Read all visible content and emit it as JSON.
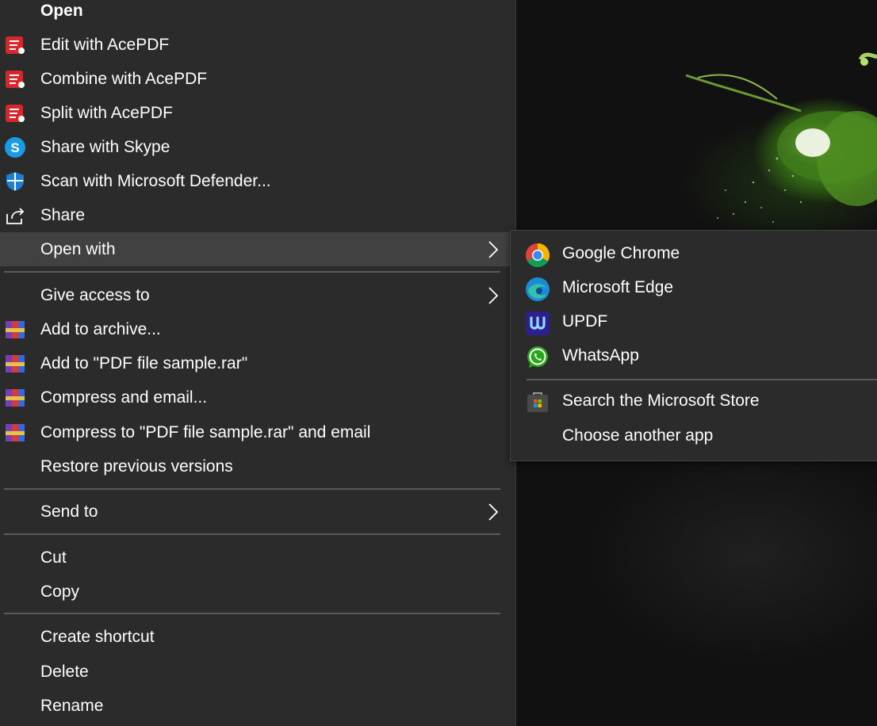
{
  "context_menu": {
    "items": [
      {
        "label": "Open",
        "icon": null,
        "bold": true
      },
      {
        "label": "Edit with AcePDF",
        "icon": "acepdf-icon"
      },
      {
        "label": "Combine with AcePDF",
        "icon": "acepdf-icon"
      },
      {
        "label": "Split with AcePDF",
        "icon": "acepdf-icon"
      },
      {
        "label": "Share with Skype",
        "icon": "skype-icon"
      },
      {
        "label": "Scan with Microsoft Defender...",
        "icon": "defender-shield-icon"
      },
      {
        "label": "Share",
        "icon": "share-icon"
      },
      {
        "label": "Open with",
        "icon": null,
        "submenu": true
      },
      {
        "label": "Give access to",
        "icon": null,
        "submenu": true
      },
      {
        "label": "Add to archive...",
        "icon": "winrar-icon"
      },
      {
        "label": "Add to \"PDF file sample.rar\"",
        "icon": "winrar-icon"
      },
      {
        "label": "Compress and email...",
        "icon": "winrar-icon"
      },
      {
        "label": "Compress to \"PDF file sample.rar\" and email",
        "icon": "winrar-icon"
      },
      {
        "label": "Restore previous versions",
        "icon": null
      },
      {
        "label": "Send to",
        "icon": null,
        "submenu": true
      },
      {
        "label": "Cut",
        "icon": null
      },
      {
        "label": "Copy",
        "icon": null
      },
      {
        "label": "Create shortcut",
        "icon": null
      },
      {
        "label": "Delete",
        "icon": null
      },
      {
        "label": "Rename",
        "icon": null
      }
    ]
  },
  "open_with_submenu": {
    "items": [
      {
        "label": "Google Chrome",
        "icon": "chrome-icon"
      },
      {
        "label": "Microsoft Edge",
        "icon": "edge-icon"
      },
      {
        "label": "UPDF",
        "icon": "updf-icon"
      },
      {
        "label": "WhatsApp",
        "icon": "whatsapp-icon"
      },
      {
        "label": "Search the Microsoft Store",
        "icon": "microsoft-store-icon"
      },
      {
        "label": "Choose another app",
        "icon": null
      }
    ]
  },
  "colors": {
    "menu_bg": "#2b2b2b",
    "hover_bg": "#414141",
    "separator": "#5a5a5a",
    "text": "#ffffff"
  }
}
